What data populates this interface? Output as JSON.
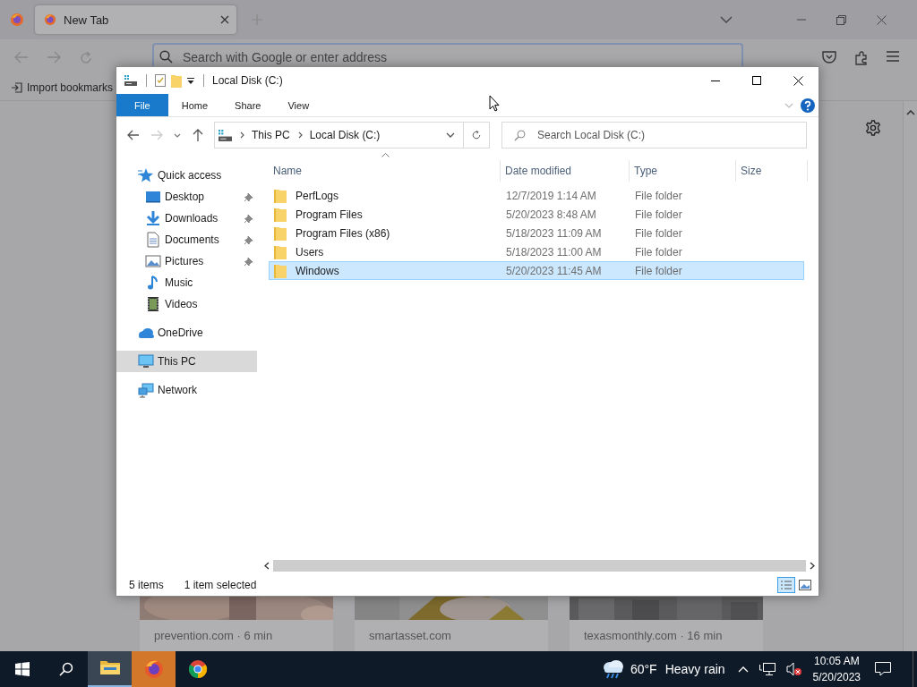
{
  "browser": {
    "tabs": [
      {
        "label": "New Tab",
        "selected": true
      }
    ],
    "address_bar": {
      "placeholder": "Search with Google or enter address"
    },
    "bookmarks": [
      "Import bookmarks"
    ],
    "stories": [
      {
        "kind": "picture",
        "source": "prevention.com · 6 min"
      },
      {
        "kind": "picture",
        "source": "smartasset.com"
      },
      {
        "kind": "picture",
        "source": "texasmonthly.com · 16 min"
      }
    ]
  },
  "explorer": {
    "title": "Local Disk (C:)",
    "ribbon_tabs": [
      {
        "label": "File",
        "kind": "menu"
      },
      {
        "label": "Home",
        "kind": "tab"
      },
      {
        "label": "Share",
        "kind": "tab"
      },
      {
        "label": "View",
        "kind": "tab"
      }
    ],
    "breadcrumb": [
      "This PC",
      "Local Disk (C:)"
    ],
    "search": {
      "placeholder": "Search Local Disk (C:)"
    },
    "nav": [
      {
        "label": "Quick access",
        "kind": "star",
        "selected": false,
        "children": [
          {
            "label": "Desktop",
            "kind": "desktop",
            "pinned": true,
            "selected": false
          },
          {
            "label": "Downloads",
            "kind": "download",
            "pinned": true,
            "selected": false
          },
          {
            "label": "Documents",
            "kind": "document",
            "pinned": true,
            "selected": false
          },
          {
            "label": "Pictures",
            "kind": "pictures",
            "pinned": true,
            "selected": false
          },
          {
            "label": "Music",
            "kind": "music",
            "pinned": false,
            "selected": false
          },
          {
            "label": "Videos",
            "kind": "video",
            "pinned": false,
            "selected": false
          }
        ]
      },
      {
        "label": "OneDrive",
        "kind": "cloud",
        "selected": false
      },
      {
        "label": "This PC",
        "kind": "pc",
        "selected": true
      },
      {
        "label": "Network",
        "kind": "network",
        "selected": false
      }
    ],
    "columns": [
      "Name",
      "Date modified",
      "Type",
      "Size"
    ],
    "rows": [
      {
        "name": "PerfLogs",
        "date": "12/7/2019 1:14 AM",
        "type": "File folder",
        "selected": false
      },
      {
        "name": "Program Files",
        "date": "5/20/2023 8:48 AM",
        "type": "File folder",
        "selected": false
      },
      {
        "name": "Program Files (x86)",
        "date": "5/18/2023 11:09 AM",
        "type": "File folder",
        "selected": false
      },
      {
        "name": "Users",
        "date": "5/18/2023 11:00 AM",
        "type": "File folder",
        "selected": false
      },
      {
        "name": "Windows",
        "date": "5/20/2023 11:45 AM",
        "type": "File folder",
        "selected": true
      }
    ],
    "status": {
      "count": "5 items",
      "selection": "1 item selected"
    }
  },
  "taskbar": {
    "apps": [
      {
        "kind": "explorer",
        "open": true,
        "attention": false
      },
      {
        "kind": "firefox",
        "open": false,
        "attention": true
      },
      {
        "kind": "chrome",
        "open": false,
        "attention": false
      }
    ],
    "weather": {
      "temperature": "60°F",
      "condition": "Heavy rain"
    },
    "clock": {
      "time": "10:05 AM",
      "date": "5/20/2023"
    }
  }
}
